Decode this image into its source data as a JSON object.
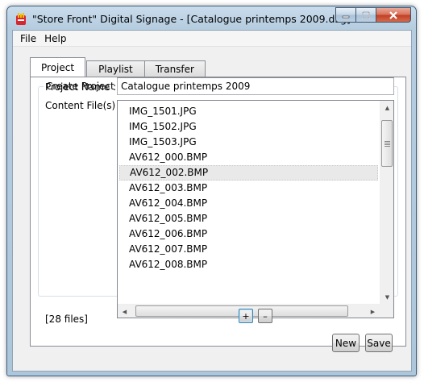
{
  "window": {
    "title": "\"Store Front\" Digital Signage - [Catalogue printemps 2009.dsg]"
  },
  "menu": {
    "items": [
      "File",
      "Help"
    ]
  },
  "tabs": [
    "Project",
    "Playlist",
    "Transfer"
  ],
  "project": {
    "group_label": "Create Project",
    "name_label": "Project Name  :",
    "name_value": "Catalogue printemps 2009",
    "content_label": "Content File(s) :",
    "files": [
      "IMG_1501.JPG",
      "IMG_1502.JPG",
      "IMG_1503.JPG",
      "AV612_000.BMP",
      "AV612_002.BMP",
      "AV612_003.BMP",
      "AV612_004.BMP",
      "AV612_005.BMP",
      "AV612_006.BMP",
      "AV612_007.BMP",
      "AV612_008.BMP"
    ],
    "selected_index": 4,
    "file_count": "[28 files]",
    "add_label": "+",
    "remove_label": "–"
  },
  "buttons": {
    "new_label": "New",
    "save_label": "Save"
  },
  "colors": {
    "selection": "#e9e9e9",
    "close_button": "#c13e22"
  }
}
